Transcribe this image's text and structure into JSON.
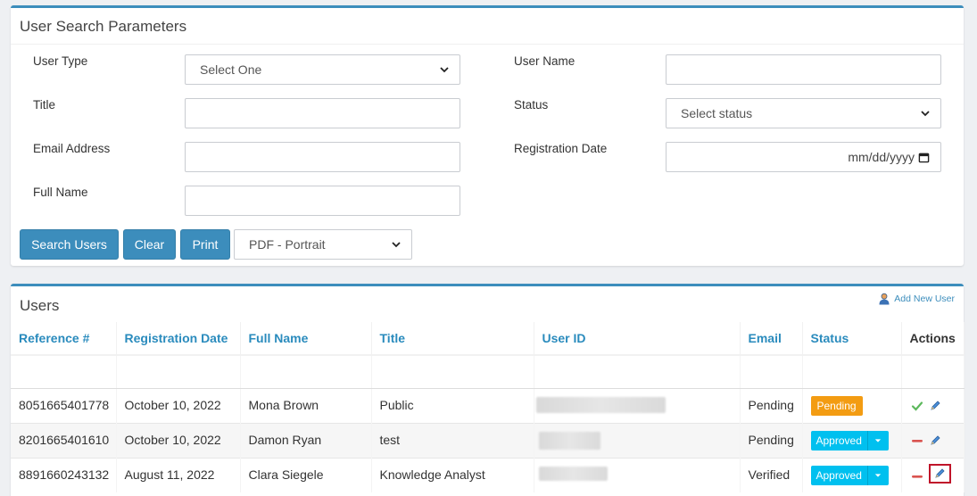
{
  "search_panel": {
    "title": "User Search Parameters",
    "fields": {
      "user_type": {
        "label": "User Type",
        "value": "Select One"
      },
      "user_name": {
        "label": "User Name",
        "value": ""
      },
      "title": {
        "label": "Title",
        "value": ""
      },
      "status": {
        "label": "Status",
        "value": "Select status"
      },
      "email": {
        "label": "Email Address",
        "value": ""
      },
      "registration_date": {
        "label": "Registration Date",
        "placeholder": "mm/dd/yyyy"
      },
      "full_name": {
        "label": "Full Name",
        "value": ""
      }
    },
    "buttons": {
      "search": "Search Users",
      "clear": "Clear",
      "print": "Print"
    },
    "print_format": "PDF - Portrait"
  },
  "users_panel": {
    "title": "Users",
    "add_user_label": "Add New User",
    "columns": [
      "Reference #",
      "Registration Date",
      "Full Name",
      "Title",
      "User ID",
      "Email",
      "Status",
      "Actions"
    ],
    "rows": [
      {
        "reference": "8051665401778",
        "registration_date": "October 10, 2022",
        "full_name": "Mona Brown",
        "title": "Public",
        "email": "Pending",
        "status": "Pending"
      },
      {
        "reference": "8201665401610",
        "registration_date": "October 10, 2022",
        "full_name": "Damon Ryan",
        "title": "test",
        "email": "Pending",
        "status": "Approved"
      },
      {
        "reference": "8891660243132",
        "registration_date": "August 11, 2022",
        "full_name": "Clara Siegele",
        "title": "Knowledge Analyst",
        "email": "Verified",
        "status": "Approved"
      }
    ]
  },
  "colors": {
    "primary": "#3c8dbc",
    "pending": "#f39c12",
    "approved": "#00c0ef",
    "header_link": "#2a8bbd",
    "highlight_box": "#c0142a"
  },
  "icons": {
    "select_caret": "chevron-down-icon",
    "date_picker": "calendar-icon",
    "add_user": "user-icon",
    "approve": "check-icon",
    "disable": "minus-icon",
    "edit": "pencil-icon"
  }
}
